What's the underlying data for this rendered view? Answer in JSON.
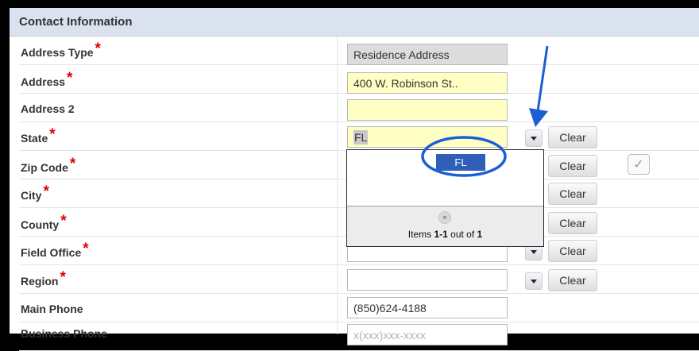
{
  "section": {
    "title": "Contact Information"
  },
  "required_marker": "*",
  "fields": {
    "address_type": {
      "label": "Address Type",
      "value": "Residence Address"
    },
    "address": {
      "label": "Address",
      "value": "400 W. Robinson St.."
    },
    "address2": {
      "label": "Address 2",
      "value": ""
    },
    "state": {
      "label": "State",
      "value": "FL"
    },
    "zip": {
      "label": "Zip Code"
    },
    "city": {
      "label": "City"
    },
    "county": {
      "label": "County"
    },
    "field_office": {
      "label": "Field Office"
    },
    "region": {
      "label": "Region",
      "value": ""
    },
    "main_phone": {
      "label": "Main Phone",
      "value": "(850)624-4188"
    },
    "business_phone": {
      "label": "Business Phone",
      "placeholder": "x(xxx)xxx-xxxx"
    }
  },
  "buttons": {
    "clear_label": "Clear"
  },
  "dropdown": {
    "options": [
      "FL"
    ],
    "footer": {
      "prefix": "Items ",
      "range": "1-1",
      "middle": " out of ",
      "total": "1"
    }
  },
  "colors": {
    "header_bg": "#dbe2ef",
    "required": "#e00000",
    "highlight_input": "#ffffc4",
    "selected_option": "#2f5fb8",
    "annotation": "#1a5fd6"
  },
  "icons": {
    "dropdown": "triangle-down",
    "more": "double-chevron-down",
    "checkbox": "checkmark",
    "annotation_arrow": "arrow-down",
    "annotation_circle": "ellipse"
  }
}
